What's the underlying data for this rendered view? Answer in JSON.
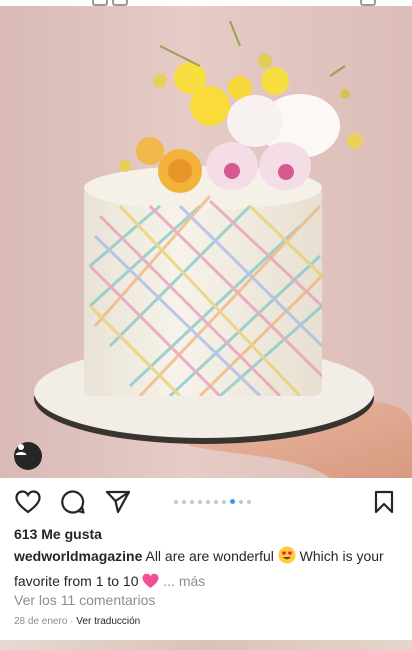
{
  "post": {
    "likes": "613 Me gusta",
    "username": "wedworldmagazine",
    "caption_part1": "All are are wonderful",
    "caption_part2": "Which is your favorite from 1 to 10",
    "caption_more": "... más",
    "comments_link": "Ver los 11 comentarios",
    "date": "28 de enero",
    "separator": "·",
    "translate": "Ver traducción"
  },
  "carousel": {
    "total": 10,
    "active_index": 7
  },
  "icons": {
    "like": "heart-icon",
    "comment": "comment-icon",
    "share": "send-icon",
    "save": "bookmark-icon",
    "user_tag": "user-tag-icon"
  },
  "colors": {
    "active_dot": "#3897f0",
    "text": "#262626",
    "muted": "#8e8e8e"
  }
}
